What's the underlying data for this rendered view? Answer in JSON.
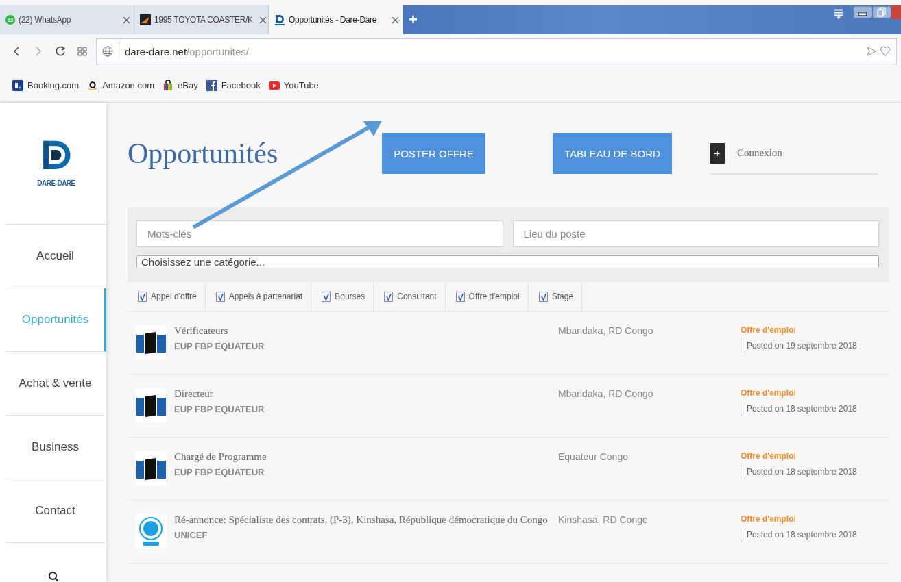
{
  "browser": {
    "tabs": [
      {
        "badge": "22",
        "title": "(22) WhatsApp",
        "selected": false
      },
      {
        "title": "1995 TOYOTA COASTER/K",
        "selected": false
      },
      {
        "title": "Opportunités - Dare-Dare",
        "selected": true
      }
    ],
    "new_tab": "+",
    "address": {
      "domain": "dare-dare.net",
      "path": "/opportunites/"
    },
    "bookmarks": [
      {
        "label": "Booking.com"
      },
      {
        "label": "Amazon.com"
      },
      {
        "label": "eBay"
      },
      {
        "label": "Facebook"
      },
      {
        "label": "YouTube"
      }
    ]
  },
  "sidebar": {
    "logo_text": "DARE-DARE",
    "items": [
      {
        "label": "Accueil",
        "selected": false
      },
      {
        "label": "Opportunités",
        "selected": true
      },
      {
        "label": "Achat & vente",
        "selected": false
      },
      {
        "label": "Business",
        "selected": false
      },
      {
        "label": "Contact",
        "selected": false
      }
    ]
  },
  "page": {
    "title": "Opportunités",
    "buttons": [
      "POSTER OFFRE",
      "TABLEAU DE BORD"
    ],
    "login_icon": "+",
    "login": "Connexion"
  },
  "search": {
    "keywords": {
      "placeholder": "Mots-clés"
    },
    "location": {
      "placeholder": "Lieu du poste"
    },
    "category": {
      "placeholder": "Choisissez une catégorie..."
    }
  },
  "filters": [
    {
      "label": "Appel d'offre",
      "checked": true
    },
    {
      "label": "Appels à partenariat",
      "checked": true
    },
    {
      "label": "Bourses",
      "checked": true
    },
    {
      "label": "Consultant",
      "checked": true
    },
    {
      "label": "Offre d'emploi",
      "checked": true
    },
    {
      "label": "Stage",
      "checked": true
    }
  ],
  "listings": [
    {
      "kind": "fbp",
      "title": "Vérificateurs",
      "org": "EUP FBP EQUATEUR",
      "location": "Mbandaka, RD Congo",
      "type": "Offre d'emploi",
      "posted": "Posted on 19 septembre 2018"
    },
    {
      "kind": "fbp",
      "title": "Directeur",
      "org": "EUP FBP EQUATEUR",
      "location": "Mbandaka, RD Congo",
      "type": "Offre d'emploi",
      "posted": "Posted on 18 septembre 2018"
    },
    {
      "kind": "fbp",
      "title": "Chargé de Programme",
      "org": "EUP FBP EQUATEUR",
      "location": "Equateur Congo",
      "type": "Offre d'emploi",
      "posted": "Posted on 18 septembre 2018"
    },
    {
      "kind": "unicef",
      "title": "Ré-annonce: Spécialiste des contrats, (P-3), Kinshasa, République démocratique du Congo",
      "org": "UNICEF",
      "location": "Kinshasa, RD Congo",
      "type": "Offre d'emploi",
      "posted": "Posted on 18 septembre 2018"
    }
  ]
}
